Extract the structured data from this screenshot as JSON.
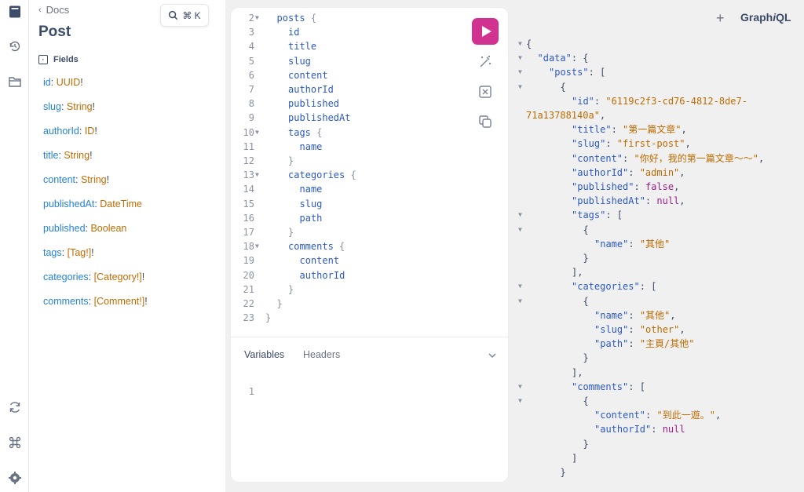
{
  "search_shortcut": "⌘ K",
  "docs": {
    "back_label": "Docs",
    "title": "Post",
    "fields_heading": "Fields",
    "fields": [
      {
        "name": "id",
        "type": "UUID",
        "suffix": "!"
      },
      {
        "name": "slug",
        "type": "String",
        "suffix": "!"
      },
      {
        "name": "authorId",
        "type": "ID",
        "suffix": "!"
      },
      {
        "name": "title",
        "type": "String",
        "suffix": "!"
      },
      {
        "name": "content",
        "type": "String",
        "suffix": "!"
      },
      {
        "name": "publishedAt",
        "type": "DateTime",
        "suffix": ""
      },
      {
        "name": "published",
        "type": "Boolean",
        "suffix": ""
      },
      {
        "name": "tags",
        "type": "[Tag!]",
        "suffix": "!"
      },
      {
        "name": "categories",
        "type": "[Category!]",
        "suffix": "!"
      },
      {
        "name": "comments",
        "type": "[Comment!]",
        "suffix": "!"
      }
    ]
  },
  "editor": {
    "query_lines": [
      {
        "n": "2",
        "fold": true,
        "indent": 1,
        "text": "posts",
        "brace": " {"
      },
      {
        "n": "3",
        "fold": false,
        "indent": 2,
        "text": "id",
        "brace": ""
      },
      {
        "n": "4",
        "fold": false,
        "indent": 2,
        "text": "title",
        "brace": ""
      },
      {
        "n": "5",
        "fold": false,
        "indent": 2,
        "text": "slug",
        "brace": ""
      },
      {
        "n": "6",
        "fold": false,
        "indent": 2,
        "text": "content",
        "brace": ""
      },
      {
        "n": "7",
        "fold": false,
        "indent": 2,
        "text": "authorId",
        "brace": ""
      },
      {
        "n": "8",
        "fold": false,
        "indent": 2,
        "text": "published",
        "brace": ""
      },
      {
        "n": "9",
        "fold": false,
        "indent": 2,
        "text": "publishedAt",
        "brace": ""
      },
      {
        "n": "10",
        "fold": true,
        "indent": 2,
        "text": "tags",
        "brace": " {"
      },
      {
        "n": "11",
        "fold": false,
        "indent": 3,
        "text": "name",
        "brace": ""
      },
      {
        "n": "12",
        "fold": false,
        "indent": 2,
        "text": "",
        "brace": "}"
      },
      {
        "n": "13",
        "fold": true,
        "indent": 2,
        "text": "categories",
        "brace": " {"
      },
      {
        "n": "14",
        "fold": false,
        "indent": 3,
        "text": "name",
        "brace": ""
      },
      {
        "n": "15",
        "fold": false,
        "indent": 3,
        "text": "slug",
        "brace": ""
      },
      {
        "n": "16",
        "fold": false,
        "indent": 3,
        "text": "path",
        "brace": ""
      },
      {
        "n": "17",
        "fold": false,
        "indent": 2,
        "text": "",
        "brace": "}"
      },
      {
        "n": "18",
        "fold": true,
        "indent": 2,
        "text": "comments",
        "brace": " {"
      },
      {
        "n": "19",
        "fold": false,
        "indent": 3,
        "text": "content",
        "brace": ""
      },
      {
        "n": "20",
        "fold": false,
        "indent": 3,
        "text": "authorId",
        "brace": ""
      },
      {
        "n": "21",
        "fold": false,
        "indent": 2,
        "text": "",
        "brace": "}"
      },
      {
        "n": "22",
        "fold": false,
        "indent": 1,
        "text": "",
        "brace": "}"
      },
      {
        "n": "23",
        "fold": false,
        "indent": 0,
        "text": "",
        "brace": "}"
      }
    ],
    "variables_tab": "Variables",
    "headers_tab": "Headers",
    "variables_line_number": "1"
  },
  "brand": {
    "graph": "Graph",
    "i": "i",
    "ql": "QL"
  },
  "result_lines": [
    {
      "fold": true,
      "indent": 0,
      "parts": [
        [
          "p",
          "{"
        ]
      ]
    },
    {
      "fold": true,
      "indent": 1,
      "parts": [
        [
          "k",
          "\"data\""
        ],
        [
          "p",
          ": {"
        ]
      ]
    },
    {
      "fold": true,
      "indent": 2,
      "parts": [
        [
          "k",
          "\"posts\""
        ],
        [
          "p",
          ": ["
        ]
      ]
    },
    {
      "fold": true,
      "indent": 3,
      "parts": [
        [
          "p",
          "{"
        ]
      ]
    },
    {
      "fold": false,
      "indent": 4,
      "parts": [
        [
          "k",
          "\"id\""
        ],
        [
          "p",
          ": "
        ],
        [
          "s",
          "\"6119c2f3-cd76-4812-8de7-"
        ]
      ]
    },
    {
      "fold": false,
      "indent": 0,
      "parts": [
        [
          "s",
          "71a13788140a\""
        ],
        [
          "p",
          ","
        ]
      ]
    },
    {
      "fold": false,
      "indent": 4,
      "parts": [
        [
          "k",
          "\"title\""
        ],
        [
          "p",
          ": "
        ],
        [
          "s",
          "\"第一篇文章\""
        ],
        [
          "p",
          ","
        ]
      ]
    },
    {
      "fold": false,
      "indent": 4,
      "parts": [
        [
          "k",
          "\"slug\""
        ],
        [
          "p",
          ": "
        ],
        [
          "s",
          "\"first-post\""
        ],
        [
          "p",
          ","
        ]
      ]
    },
    {
      "fold": false,
      "indent": 4,
      "parts": [
        [
          "k",
          "\"content\""
        ],
        [
          "p",
          ": "
        ],
        [
          "s",
          "\"你好，我的第一篇文章～～\""
        ],
        [
          "p",
          ","
        ]
      ]
    },
    {
      "fold": false,
      "indent": 4,
      "parts": [
        [
          "k",
          "\"authorId\""
        ],
        [
          "p",
          ": "
        ],
        [
          "s",
          "\"admin\""
        ],
        [
          "p",
          ","
        ]
      ]
    },
    {
      "fold": false,
      "indent": 4,
      "parts": [
        [
          "k",
          "\"published\""
        ],
        [
          "p",
          ": "
        ],
        [
          "n",
          "false"
        ],
        [
          "p",
          ","
        ]
      ]
    },
    {
      "fold": false,
      "indent": 4,
      "parts": [
        [
          "k",
          "\"publishedAt\""
        ],
        [
          "p",
          ": "
        ],
        [
          "n",
          "null"
        ],
        [
          "p",
          ","
        ]
      ]
    },
    {
      "fold": true,
      "indent": 4,
      "parts": [
        [
          "k",
          "\"tags\""
        ],
        [
          "p",
          ": ["
        ]
      ]
    },
    {
      "fold": true,
      "indent": 5,
      "parts": [
        [
          "p",
          "{"
        ]
      ]
    },
    {
      "fold": false,
      "indent": 6,
      "parts": [
        [
          "k",
          "\"name\""
        ],
        [
          "p",
          ": "
        ],
        [
          "s",
          "\"其他\""
        ]
      ]
    },
    {
      "fold": false,
      "indent": 5,
      "parts": [
        [
          "p",
          "}"
        ]
      ]
    },
    {
      "fold": false,
      "indent": 4,
      "parts": [
        [
          "p",
          "],"
        ]
      ]
    },
    {
      "fold": true,
      "indent": 4,
      "parts": [
        [
          "k",
          "\"categories\""
        ],
        [
          "p",
          ": ["
        ]
      ]
    },
    {
      "fold": true,
      "indent": 5,
      "parts": [
        [
          "p",
          "{"
        ]
      ]
    },
    {
      "fold": false,
      "indent": 6,
      "parts": [
        [
          "k",
          "\"name\""
        ],
        [
          "p",
          ": "
        ],
        [
          "s",
          "\"其他\""
        ],
        [
          "p",
          ","
        ]
      ]
    },
    {
      "fold": false,
      "indent": 6,
      "parts": [
        [
          "k",
          "\"slug\""
        ],
        [
          "p",
          ": "
        ],
        [
          "s",
          "\"other\""
        ],
        [
          "p",
          ","
        ]
      ]
    },
    {
      "fold": false,
      "indent": 6,
      "parts": [
        [
          "k",
          "\"path\""
        ],
        [
          "p",
          ": "
        ],
        [
          "s",
          "\"主頁/其他\""
        ]
      ]
    },
    {
      "fold": false,
      "indent": 5,
      "parts": [
        [
          "p",
          "}"
        ]
      ]
    },
    {
      "fold": false,
      "indent": 4,
      "parts": [
        [
          "p",
          "],"
        ]
      ]
    },
    {
      "fold": true,
      "indent": 4,
      "parts": [
        [
          "k",
          "\"comments\""
        ],
        [
          "p",
          ": ["
        ]
      ]
    },
    {
      "fold": true,
      "indent": 5,
      "parts": [
        [
          "p",
          "{"
        ]
      ]
    },
    {
      "fold": false,
      "indent": 6,
      "parts": [
        [
          "k",
          "\"content\""
        ],
        [
          "p",
          ": "
        ],
        [
          "s",
          "\"到此一遊。\""
        ],
        [
          "p",
          ","
        ]
      ]
    },
    {
      "fold": false,
      "indent": 6,
      "parts": [
        [
          "k",
          "\"authorId\""
        ],
        [
          "p",
          ": "
        ],
        [
          "n",
          "null"
        ]
      ]
    },
    {
      "fold": false,
      "indent": 5,
      "parts": [
        [
          "p",
          "}"
        ]
      ]
    },
    {
      "fold": false,
      "indent": 4,
      "parts": [
        [
          "p",
          "]"
        ]
      ]
    },
    {
      "fold": false,
      "indent": 3,
      "parts": [
        [
          "p",
          "}"
        ]
      ]
    }
  ],
  "colors": {
    "accent": "#d1318f",
    "field": "#2582d8",
    "type": "#c06b00",
    "key": "#2b59c3",
    "string": "#c06b00",
    "keyword": "#9b1e8c"
  },
  "icons": [
    "docs-icon",
    "history-icon",
    "explorer-icon",
    "refetch-icon",
    "shortcut-icon",
    "settings-icon",
    "search-icon",
    "prettify-icon",
    "merge-icon",
    "copy-icon",
    "chevron-down-icon"
  ]
}
